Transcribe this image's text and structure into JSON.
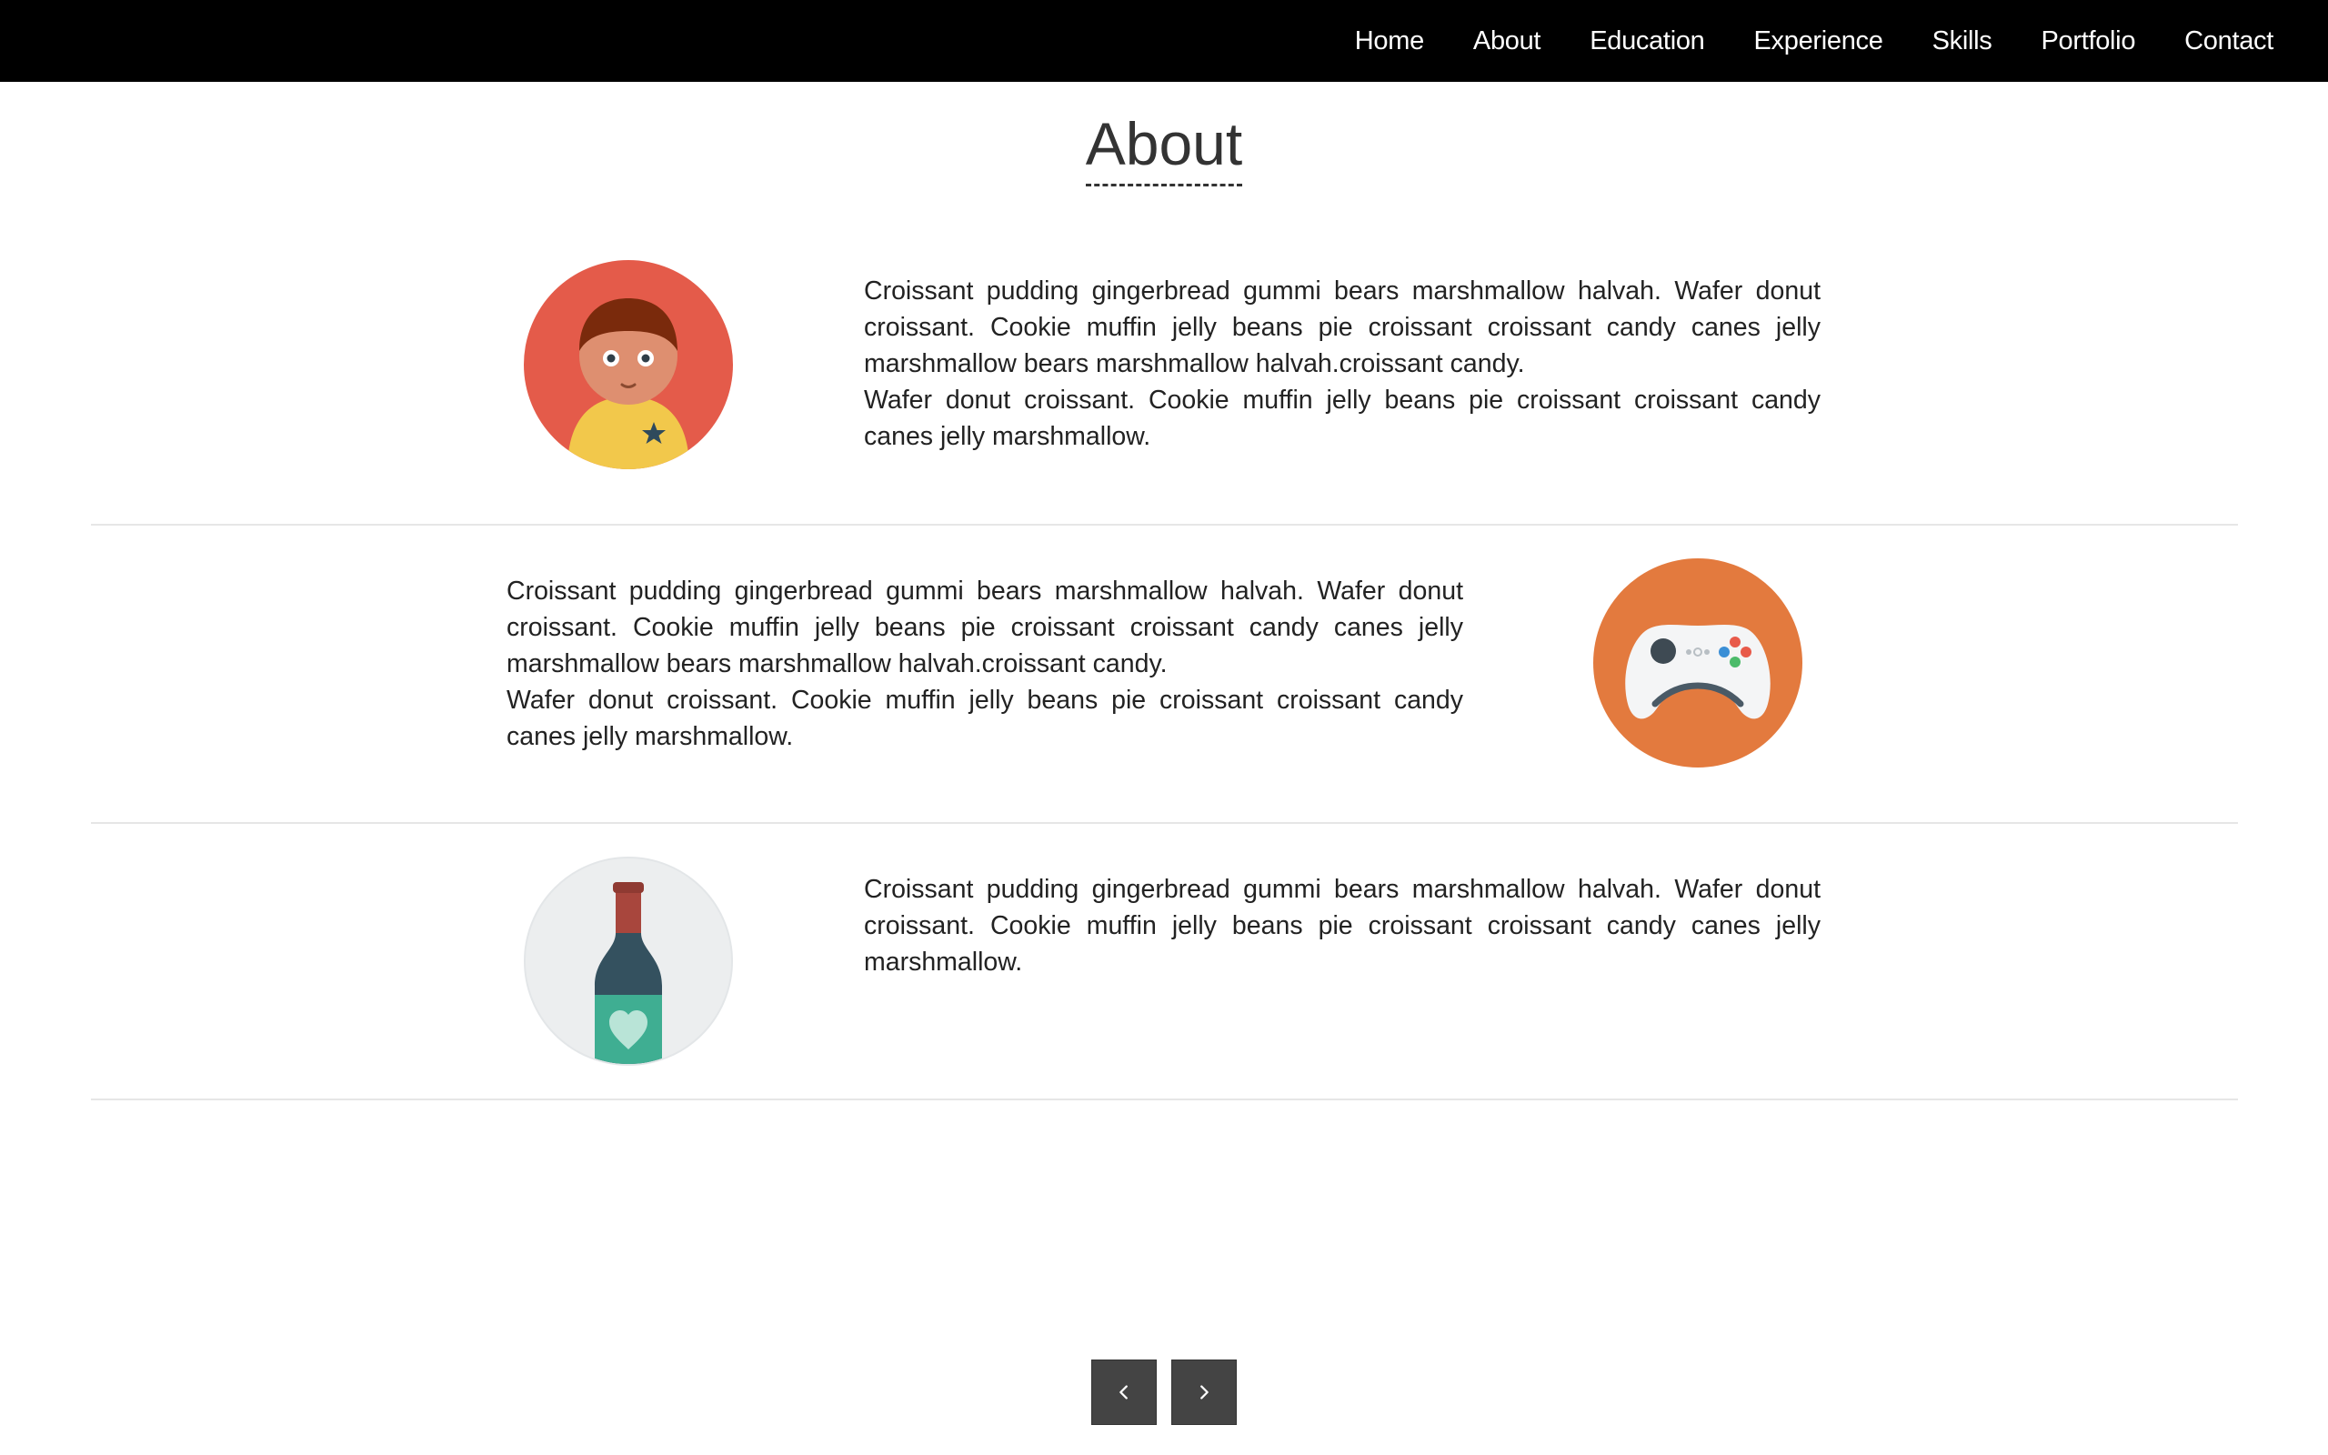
{
  "nav": {
    "items": [
      "Home",
      "About",
      "Education",
      "Experience",
      "Skills",
      "Portfolio",
      "Contact"
    ]
  },
  "page": {
    "title": "About"
  },
  "rows": [
    {
      "icon": "person-avatar-icon",
      "paragraphs": [
        "Croissant pudding gingerbread gummi bears marshmallow halvah. Wafer donut croissant. Cookie muffin jelly beans pie croissant croissant candy canes jelly marshmallow bears marshmallow halvah.croissant candy.",
        "Wafer donut croissant. Cookie muffin jelly beans pie croissant croissant candy canes jelly marshmallow."
      ]
    },
    {
      "icon": "gamepad-icon",
      "paragraphs": [
        "Croissant pudding gingerbread gummi bears marshmallow halvah. Wafer donut croissant. Cookie muffin jelly beans pie croissant croissant candy canes jelly marshmallow bears marshmallow halvah.croissant candy.",
        "Wafer donut croissant. Cookie muffin jelly beans pie croissant croissant candy canes jelly marshmallow."
      ]
    },
    {
      "icon": "wine-bottle-icon",
      "paragraphs": [
        "Croissant pudding gingerbread gummi bears marshmallow halvah. Wafer donut croissant. Cookie muffin jelly beans pie croissant croissant candy canes jelly marshmallow."
      ]
    }
  ],
  "pager": {
    "prev_icon": "chevron-left-icon",
    "next_icon": "chevron-right-icon"
  },
  "colors": {
    "nav_bg": "#000000",
    "person_bg": "#e45b4a",
    "gamepad_bg": "#e37a3e",
    "bottle_bg": "#eceeef",
    "pager_bg": "#444444"
  }
}
